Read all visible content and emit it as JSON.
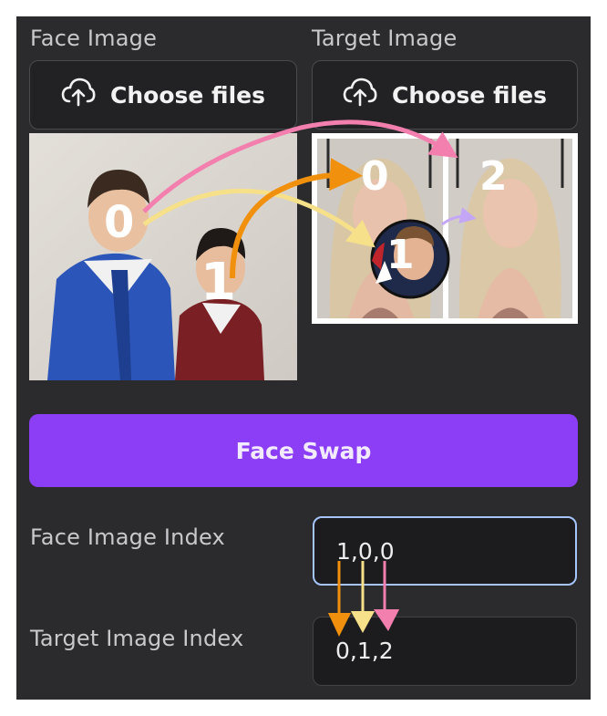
{
  "face": {
    "label": "Face Image",
    "choose_label": "Choose files",
    "upload_icon": "cloud-upload-icon"
  },
  "target": {
    "label": "Target Image",
    "choose_label": "Choose files",
    "upload_icon": "cloud-upload-icon"
  },
  "swap_button": {
    "label": "Face Swap"
  },
  "face_index": {
    "label": "Face Image Index",
    "value": "1,0,0"
  },
  "target_index": {
    "label": "Target Image Index",
    "value": "0,1,2"
  },
  "annotations": {
    "face_digits": [
      "0",
      "1"
    ],
    "target_digits": [
      "0",
      "1",
      "2"
    ]
  },
  "colors": {
    "accent": "#8b3ef6",
    "panel": "#2b2b2d",
    "focus_border": "#a6c4ff",
    "arrow_orange": "#f0900c",
    "arrow_yellow": "#f7e08a",
    "arrow_pink": "#f37fae",
    "arrow_lavender": "#c4a6f7"
  }
}
